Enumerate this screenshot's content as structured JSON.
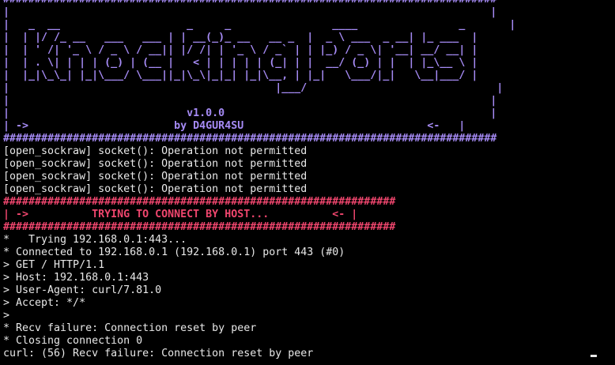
{
  "banner_top": {
    "rule": "##############################################################################",
    "ascii_art": [
      "|                                                                            |",
      "|   _  __                    _     _                ____                _       |",
      "|  | |/ /_ __   ___   ___ | | __(_)_ __   __ _  |  _ \\ ___  _ __| |_ ___  |",
      "|  | ' /| '_ \\ / _ \\ / __|| |/ /| | '_ \\ / _` | | |_) / _ \\| '__| __/ __| |",
      "|  | . \\| | | | (_) | (__ |   < | | | | | (_| | |  __/ (_) | |  | |_\\__ \\ |",
      "|  |_|\\_\\_| |_|\\___/ \\___||_|\\_\\|_|_| |_|\\__, | |_|   \\___/|_|   \\__|___/ |",
      "|                                          |___/                              |",
      "|                                                                            |"
    ],
    "version": "|                            v1.0.0                                          |",
    "author_line": "| ->                       by D4GUR4SU                             <-   |"
  },
  "sockraw_errors": [
    "[open_sockraw] socket(): Operation not permitted",
    "[open_sockraw] socket(): Operation not permitted",
    "[open_sockraw] socket(): Operation not permitted",
    "[open_sockraw] socket(): Operation not permitted"
  ],
  "host_banner": {
    "rule": "##############################################################",
    "text": "| ->          TRYING TO CONNECT BY HOST...          <- |"
  },
  "curl_output": [
    "*   Trying 192.168.0.1:443...",
    "* Connected to 192.168.0.1 (192.168.0.1) port 443 (#0)",
    "> GET / HTTP/1.1",
    "> Host: 192.168.0.1:443",
    "> User-Agent: curl/7.81.0",
    "> Accept: */*",
    ">",
    "* Recv failure: Connection reset by peer",
    "* Closing connection 0",
    "curl: (56) Recv failure: Connection reset by peer"
  ],
  "colors": {
    "background": "#000000",
    "text": "#e8e8e8",
    "banner_purple": "#a68bf5",
    "banner_pink": "#f0466e"
  }
}
